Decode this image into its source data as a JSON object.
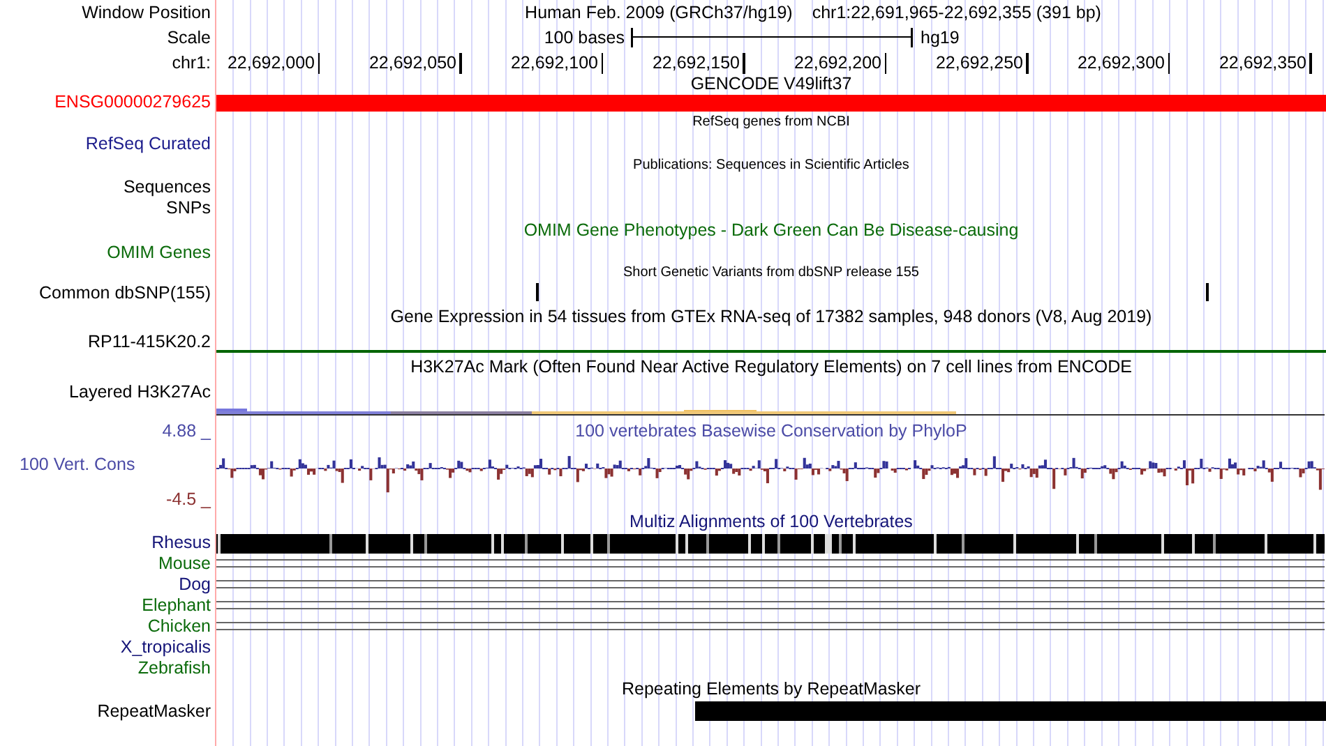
{
  "header": {
    "label": "Window Position",
    "title": "Human Feb. 2009 (GRCh37/hg19)",
    "position": "chr1:22,691,965-22,692,355 (391 bp)"
  },
  "scale": {
    "label": "Scale",
    "bar_label": "100 bases",
    "assembly": "hg19"
  },
  "ruler": {
    "label": "chr1:",
    "ticks": [
      "22,692,000",
      "22,692,050",
      "22,692,100",
      "22,692,150",
      "22,692,200",
      "22,692,250",
      "22,692,300",
      "22,692,350"
    ]
  },
  "tracks": [
    {
      "kind": "gene",
      "title": {
        "text": "GENCODE V49lift37",
        "kind": "large",
        "color": "#000000"
      },
      "color": "#ff0000",
      "labels": [
        {
          "text": "ENSG00000279625",
          "color": "#ff0000"
        }
      ]
    },
    {
      "kind": "empty",
      "title": {
        "text": "RefSeq genes from NCBI",
        "kind": "small",
        "color": "#000000"
      },
      "labels": [
        {
          "text": "RefSeq Curated",
          "color": "#1c1c8c"
        }
      ]
    },
    {
      "kind": "empty",
      "title": {
        "text": "Publications: Sequences in Scientific Articles",
        "kind": "small",
        "color": "#000000"
      },
      "labels": [
        {
          "text": "Sequences",
          "color": "#000000"
        },
        {
          "text": "SNPs",
          "color": "#000000"
        }
      ]
    },
    {
      "kind": "empty",
      "title": {
        "text": "OMIM Gene Phenotypes - Dark Green Can Be Disease-causing",
        "kind": "large",
        "color": "#0b6b0b"
      },
      "labels": [
        {
          "text": "OMIM Genes",
          "color": "#0b6b0b"
        }
      ]
    },
    {
      "kind": "snp",
      "title": {
        "text": "Short Genetic Variants from dbSNP release 155",
        "kind": "small",
        "color": "#000000"
      },
      "labels": [
        {
          "text": "Common dbSNP(155)",
          "color": "#000000"
        }
      ]
    },
    {
      "kind": "expression",
      "title": {
        "text": "Gene Expression in 54 tissues from GTEx RNA-seq of 17382 samples, 948 donors (V8, Aug 2019)",
        "kind": "large",
        "color": "#000000"
      },
      "color": "#006400",
      "labels": [
        {
          "text": "RP11-415K20.2",
          "color": "#000000"
        }
      ]
    },
    {
      "kind": "layered",
      "title": {
        "text": "H3K27Ac Mark (Often Found Near Active Regulatory Elements) on 7 cell lines from ENCODE",
        "kind": "large",
        "color": "#000000"
      },
      "labels": [
        {
          "text": "Layered H3K27Ac",
          "color": "#000000"
        }
      ]
    },
    {
      "kind": "wiggle",
      "title": {
        "text": "100 vertebrates Basewise Conservation by PhyloP",
        "kind": "large",
        "color": "#4b4ba6"
      },
      "labels": [
        {
          "text": "4.88 _",
          "color": "#4b4ba6"
        },
        {
          "text": "100 Vert. Cons",
          "color": "#4b4ba6"
        },
        {
          "text": "-4.5 _",
          "color": "#8c3232"
        }
      ]
    },
    {
      "kind": "multiz",
      "title": {
        "text": "Multiz Alignments of 100 Vertebrates",
        "kind": "large",
        "color": "#141478"
      },
      "labels": [
        {
          "text": "Rhesus",
          "color": "#141478",
          "kind": "bar"
        },
        {
          "text": "Mouse",
          "color": "#0b6b0b",
          "kind": "lines"
        },
        {
          "text": "Dog",
          "color": "#141478",
          "kind": "lines"
        },
        {
          "text": "Elephant",
          "color": "#0b6b0b",
          "kind": "lines"
        },
        {
          "text": "Chicken",
          "color": "#0b6b0b",
          "kind": "lines"
        },
        {
          "text": "X_tropicalis",
          "color": "#141478",
          "kind": "none"
        },
        {
          "text": "Zebrafish",
          "color": "#0b6b0b",
          "kind": "none"
        }
      ]
    },
    {
      "kind": "repeat",
      "title": {
        "text": "Repeating Elements by RepeatMasker",
        "kind": "large",
        "color": "#000000"
      },
      "labels": [
        {
          "text": "RepeatMasker",
          "color": "#000000"
        }
      ]
    }
  ]
}
